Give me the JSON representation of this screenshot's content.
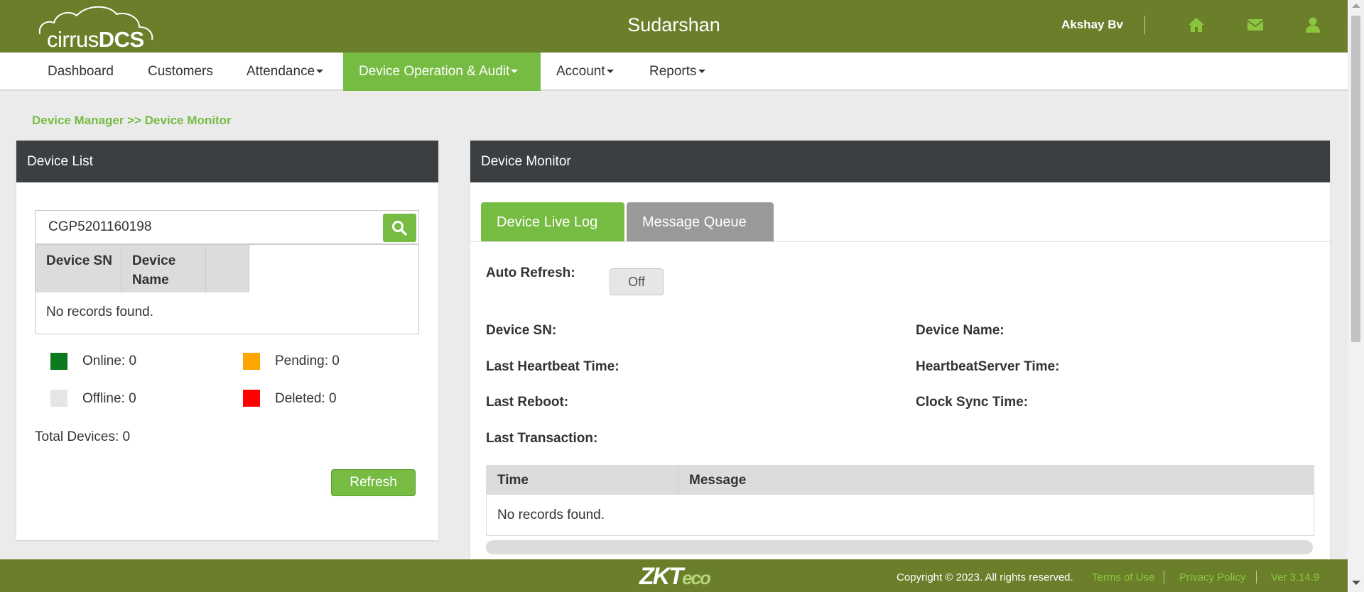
{
  "header": {
    "logo_text_light": "cirrus",
    "logo_text_bold": "DCS",
    "org_name": "Sudarshan",
    "user_name": "Akshay Bv",
    "icons": [
      "home-icon",
      "envelope-icon",
      "user-icon"
    ]
  },
  "nav": {
    "items": [
      {
        "label": "Dashboard",
        "dropdown": false
      },
      {
        "label": "Customers",
        "dropdown": false
      },
      {
        "label": "Attendance",
        "dropdown": true
      },
      {
        "label": "Device Operation & Audit",
        "dropdown": true,
        "active": true
      },
      {
        "label": "Account",
        "dropdown": true
      },
      {
        "label": "Reports",
        "dropdown": true
      }
    ]
  },
  "breadcrumb": "Device Manager >> Device Monitor",
  "device_list": {
    "title": "Device List",
    "search_value": "CGP5201160198",
    "columns": [
      "Device SN",
      "Device Name",
      ""
    ],
    "empty_text": "No records found.",
    "legend": [
      {
        "label": "Online: 0",
        "color": "#0b7a1e"
      },
      {
        "label": "Pending: 0",
        "color": "#ffa500"
      },
      {
        "label": "Offline: 0",
        "color": "#e5e5e5"
      },
      {
        "label": "Deleted: 0",
        "color": "#ff0000"
      }
    ],
    "total_devices": "Total Devices: 0",
    "refresh_label": "Refresh"
  },
  "device_monitor": {
    "title": "Device Monitor",
    "tabs": [
      "Device Live Log",
      "Message Queue"
    ],
    "auto_refresh_label": "Auto Refresh:",
    "auto_refresh_value": "Off",
    "fields": {
      "device_sn": "Device SN:",
      "device_name": "Device Name:",
      "last_heartbeat": "Last Heartbeat Time:",
      "heartbeat_server": "HeartbeatServer Time:",
      "last_reboot": "Last Reboot:",
      "clock_sync": "Clock Sync Time:",
      "last_transaction": "Last Transaction:"
    },
    "log_columns": [
      "Time",
      "Message"
    ],
    "empty_text": "No records found."
  },
  "footer": {
    "brand": "ZKTeco",
    "brand_main": "ZKT",
    "brand_sub": "eco",
    "copyright": "Copyright © 2023. All rights reserved.",
    "terms": "Terms of Use",
    "privacy": "Privacy Policy",
    "version": "Ver 3.14.9"
  },
  "colors": {
    "header_bg": "#6b7f2a",
    "accent": "#76bc43",
    "panel_head": "#3b3f42"
  }
}
